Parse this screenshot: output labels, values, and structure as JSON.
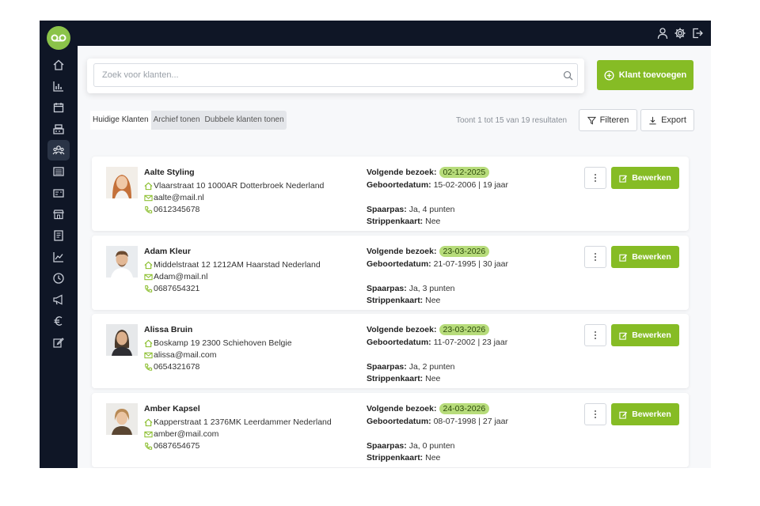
{
  "sidebar": {
    "logo": "voicemail-logo-icon",
    "items": [
      {
        "icon": "home-icon",
        "active": false
      },
      {
        "icon": "bar-chart-icon",
        "active": false
      },
      {
        "icon": "calendar-icon",
        "active": false
      },
      {
        "icon": "cash-register-icon",
        "active": false
      },
      {
        "icon": "users-icon",
        "active": true
      },
      {
        "icon": "list-icon",
        "active": false
      },
      {
        "icon": "id-card-icon",
        "active": false
      },
      {
        "icon": "storefront-icon",
        "active": false
      },
      {
        "icon": "book-icon",
        "active": false
      },
      {
        "icon": "line-chart-icon",
        "active": false
      },
      {
        "icon": "clock-icon",
        "active": false
      },
      {
        "icon": "megaphone-icon",
        "active": false
      },
      {
        "icon": "euro-icon",
        "active": false
      },
      {
        "icon": "edit-icon",
        "active": false
      }
    ]
  },
  "topbar": {
    "icons": [
      "user-icon",
      "gear-icon",
      "logout-icon"
    ]
  },
  "search": {
    "placeholder": "Zoek voor klanten..."
  },
  "add_button": {
    "label": "Klant toevoegen"
  },
  "tabs": [
    {
      "label": "Huidige Klanten",
      "active": true
    },
    {
      "label": "Archief tonen",
      "active": false
    },
    {
      "label": "Dubbele klanten tonen",
      "active": false
    }
  ],
  "results": {
    "text": "Toont 1 tot 15 van 19 resultaten"
  },
  "toolbar": {
    "filter_label": "Filteren",
    "export_label": "Export"
  },
  "labels": {
    "next_visit": "Volgende bezoek:",
    "birthdate": "Geboortedatum:",
    "loyalty": "Spaarpas:",
    "punch_card": "Strippenkaart:",
    "edit": "Bewerken"
  },
  "colors": {
    "accent": "#86bc25",
    "badge": "#b7dc7b",
    "sidebar": "#0f1626"
  },
  "clients": [
    {
      "name": "Aalte Styling",
      "address": "Vlaarstraat 10 1000AR Dotterbroek Nederland",
      "email": "aalte@mail.nl",
      "phone": "0612345678",
      "next_visit": "02-12-2025",
      "birthdate": "15-02-2006 | 19 jaar",
      "loyalty": "Ja, 4 punten",
      "punch_card": "Nee"
    },
    {
      "name": "Adam Kleur",
      "address": "Middelstraat 12 1212AM Haarstad Nederland",
      "email": "Adam@mail.nl",
      "phone": "0687654321",
      "next_visit": "23-03-2026",
      "birthdate": "21-07-1995 | 30 jaar",
      "loyalty": "Ja, 3 punten",
      "punch_card": "Nee"
    },
    {
      "name": "Alissa Bruin",
      "address": "Boskamp 19 2300 Schiehoven Belgie",
      "email": "alissa@mail.com",
      "phone": "0654321678",
      "next_visit": "23-03-2026",
      "birthdate": "11-07-2002 | 23 jaar",
      "loyalty": "Ja, 2 punten",
      "punch_card": "Nee"
    },
    {
      "name": "Amber Kapsel",
      "address": "Kapperstraat 1 2376MK Leerdammer Nederland",
      "email": "amber@mail.com",
      "phone": "0687654675",
      "next_visit": "24-03-2026",
      "birthdate": "08-07-1998 | 27 jaar",
      "loyalty": "Ja, 0 punten",
      "punch_card": "Nee"
    }
  ]
}
